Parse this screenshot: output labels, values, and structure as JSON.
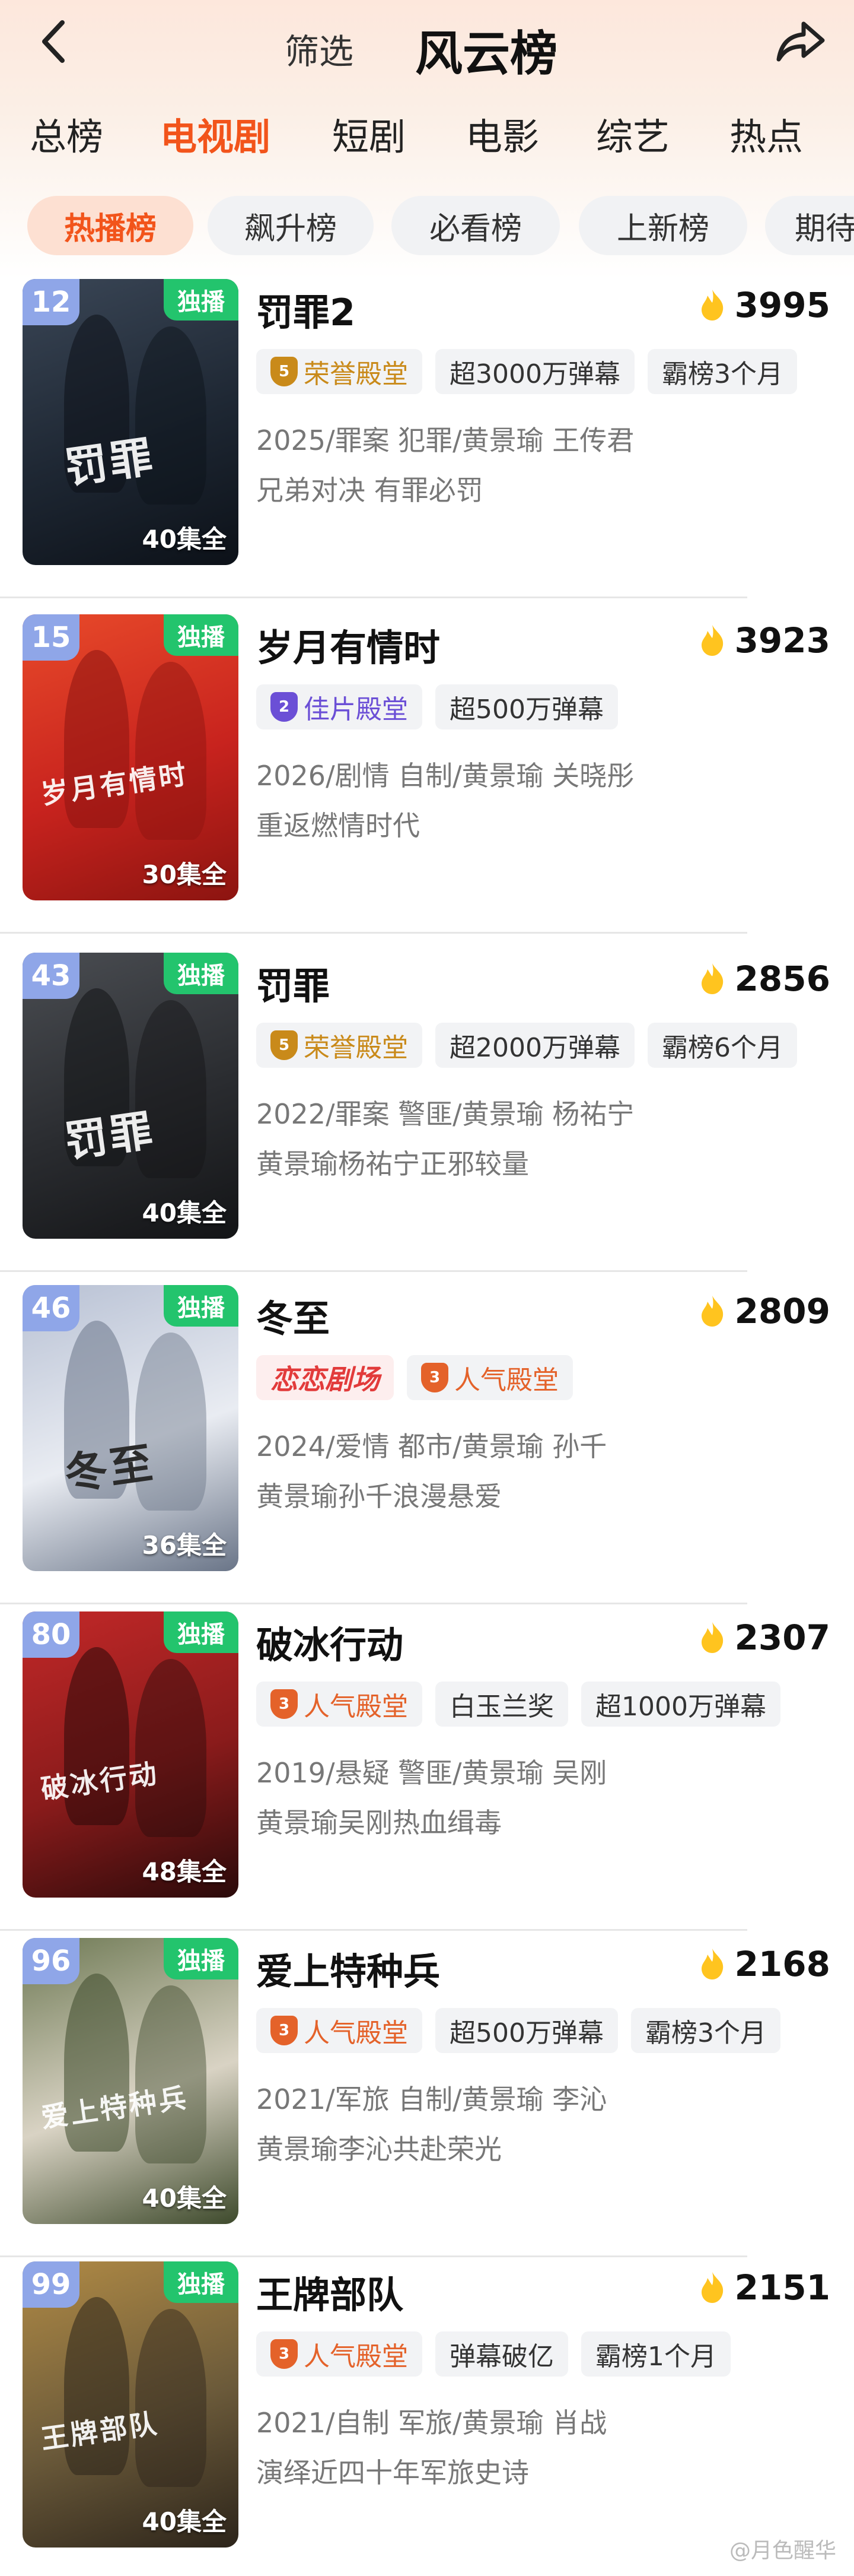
{
  "header": {
    "filter_label": "筛选",
    "title": "风云榜",
    "back_icon": "chevron-left-icon",
    "share_icon": "share-icon"
  },
  "main_tabs": [
    {
      "label": "总榜",
      "active": false
    },
    {
      "label": "电视剧",
      "active": true
    },
    {
      "label": "短剧",
      "active": false
    },
    {
      "label": "电影",
      "active": false
    },
    {
      "label": "综艺",
      "active": false
    },
    {
      "label": "热点",
      "active": false
    }
  ],
  "sub_tabs": [
    {
      "label": "热播榜",
      "active": true
    },
    {
      "label": "飙升榜",
      "active": false
    },
    {
      "label": "必看榜",
      "active": false
    },
    {
      "label": "上新榜",
      "active": false
    },
    {
      "label": "期待",
      "active": false
    }
  ],
  "colors": {
    "accent": "#f2541b",
    "exclusive": "#23c46d",
    "rank_badge": "#8fa6e8",
    "heat_icon": "#ffc41f"
  },
  "items": [
    {
      "rank": "12",
      "exclusive": "独播",
      "episodes": "40集全",
      "poster_text": "罚罪",
      "title": "罚罪2",
      "heat": "3995",
      "tags": [
        {
          "medal": "5",
          "medal_color": "gold",
          "text": "荣誉殿堂",
          "style": "gold"
        },
        {
          "text": "超3000万弹幕"
        },
        {
          "text": "霸榜3个月"
        }
      ],
      "meta": "2025/罪案 犯罪/黄景瑜 王传君",
      "desc": "兄弟对决 有罪必罚"
    },
    {
      "rank": "15",
      "exclusive": "独播",
      "episodes": "30集全",
      "poster_text": "岁月有情时",
      "title": "岁月有情时",
      "heat": "3923",
      "tags": [
        {
          "medal": "2",
          "medal_color": "purple",
          "text": "佳片殿堂",
          "style": "purple"
        },
        {
          "text": "超500万弹幕"
        }
      ],
      "meta": "2026/剧情 自制/黄景瑜 关晓彤",
      "desc": "重返燃情时代"
    },
    {
      "rank": "43",
      "exclusive": "独播",
      "episodes": "40集全",
      "poster_text": "罚罪",
      "title": "罚罪",
      "heat": "2856",
      "tags": [
        {
          "medal": "5",
          "medal_color": "gold",
          "text": "荣誉殿堂",
          "style": "gold"
        },
        {
          "text": "超2000万弹幕"
        },
        {
          "text": "霸榜6个月"
        }
      ],
      "meta": "2022/罪案 警匪/黄景瑜 杨祐宁",
      "desc": "黄景瑜杨祐宁正邪较量"
    },
    {
      "rank": "46",
      "exclusive": "独播",
      "episodes": "36集全",
      "poster_text": "冬至",
      "title": "冬至",
      "heat": "2809",
      "tags": [
        {
          "text": "恋恋剧场",
          "brand": true
        },
        {
          "medal": "3",
          "medal_color": "orange",
          "text": "人气殿堂",
          "style": "orange"
        }
      ],
      "meta": "2024/爱情 都市/黄景瑜 孙千",
      "desc": "黄景瑜孙千浪漫悬爱"
    },
    {
      "rank": "80",
      "exclusive": "独播",
      "episodes": "48集全",
      "poster_text": "破冰行动",
      "title": "破冰行动",
      "heat": "2307",
      "tags": [
        {
          "medal": "3",
          "medal_color": "orange",
          "text": "人气殿堂",
          "style": "orange"
        },
        {
          "text": "白玉兰奖"
        },
        {
          "text": "超1000万弹幕"
        }
      ],
      "meta": "2019/悬疑 警匪/黄景瑜 吴刚",
      "desc": "黄景瑜吴刚热血缉毒"
    },
    {
      "rank": "96",
      "exclusive": "独播",
      "episodes": "40集全",
      "poster_text": "爱上特种兵",
      "title": "爱上特种兵",
      "heat": "2168",
      "tags": [
        {
          "medal": "3",
          "medal_color": "orange",
          "text": "人气殿堂",
          "style": "orange"
        },
        {
          "text": "超500万弹幕"
        },
        {
          "text": "霸榜3个月"
        }
      ],
      "meta": "2021/军旅 自制/黄景瑜 李沁",
      "desc": "黄景瑜李沁共赴荣光"
    },
    {
      "rank": "99",
      "exclusive": "独播",
      "episodes": "40集全",
      "poster_text": "王牌部队",
      "title": "王牌部队",
      "heat": "2151",
      "tags": [
        {
          "medal": "3",
          "medal_color": "orange",
          "text": "人气殿堂",
          "style": "orange"
        },
        {
          "text": "弹幕破亿"
        },
        {
          "text": "霸榜1个月"
        }
      ],
      "meta": "2021/自制 军旅/黄景瑜 肖战",
      "desc": "演绎近四十年军旅史诗"
    }
  ],
  "watermark": "@月色醒华"
}
